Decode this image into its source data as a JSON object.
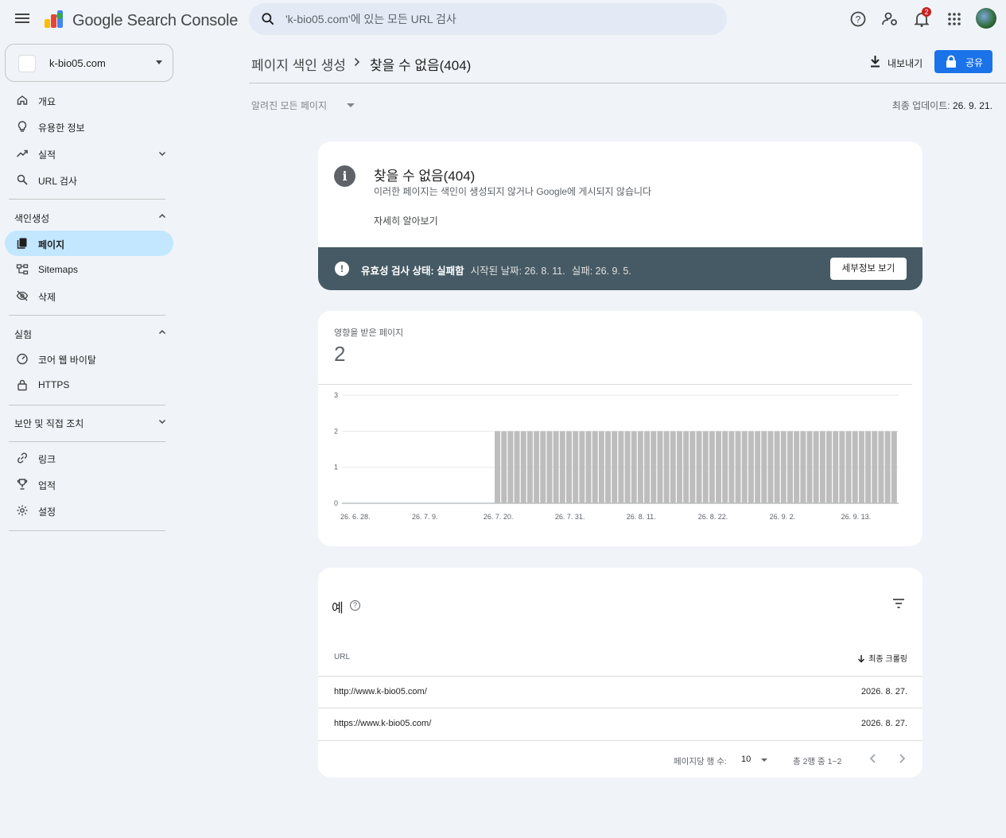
{
  "app": {
    "brand": "Google Search Console"
  },
  "search": {
    "placeholder": "'k-bio05.com'에 있는 모든 URL 검사"
  },
  "notifications": {
    "count": "2"
  },
  "property": {
    "name": "k-bio05.com"
  },
  "sidebar": {
    "top_items": [
      {
        "label": "개요",
        "icon": "home-icon"
      },
      {
        "label": "유용한 정보",
        "icon": "lightbulb-icon"
      },
      {
        "label": "실적",
        "icon": "trending-up-icon"
      },
      {
        "label": "URL 검사",
        "icon": "search-icon"
      }
    ],
    "indexing": {
      "label": "색인생성",
      "items": [
        {
          "label": "페이지",
          "icon": "pages-icon"
        },
        {
          "label": "Sitemaps",
          "icon": "sitemap-icon"
        },
        {
          "label": "삭제",
          "icon": "eye-off-icon"
        }
      ]
    },
    "experience": {
      "label": "실험",
      "items": [
        {
          "label": "코어 웹 바이탈",
          "icon": "gauge-icon"
        },
        {
          "label": "HTTPS",
          "icon": "lock-icon"
        }
      ]
    },
    "security": {
      "label": "보안 및 직접 조치"
    },
    "bottom_items": [
      {
        "label": "링크",
        "icon": "link-icon"
      },
      {
        "label": "업적",
        "icon": "trophy-icon"
      },
      {
        "label": "설정",
        "icon": "gear-icon"
      }
    ]
  },
  "header": {
    "breadcrumb_parent": "페이지 색인 생성",
    "breadcrumb_current": "찾을 수 없음(404)",
    "export_label": "내보내기",
    "share_label": "공유",
    "filter_label": "알려진 모든 페이지",
    "updated_prefix": "최종 업데이트:",
    "updated_value": "26. 9. 21."
  },
  "info_card": {
    "title": "찾을 수 없음(404)",
    "description": "이러한 페이지는 색인이 생성되지 않거나 Google에 게시되지 않습니다",
    "learn_more": "자세히 알아보기",
    "status_label": "유효성 검사 상태: 실패함",
    "started": "시작된 날짜: 26. 8. 11.",
    "failed": "실패: 26. 9. 5.",
    "details_button": "세부정보 보기"
  },
  "affected": {
    "label": "영향을 받은 페이지",
    "value": "2"
  },
  "chart_data": {
    "type": "bar",
    "y_ticks": [
      "0",
      "1",
      "2",
      "3"
    ],
    "ylim": [
      0,
      3
    ],
    "x_tick_labels": [
      "26. 6. 28.",
      "26. 7. 9.",
      "26. 7. 20.",
      "26. 7. 31.",
      "26. 8. 11.",
      "26. 8. 22.",
      "26. 9. 2.",
      "26. 9. 13."
    ],
    "x_start": "26. 6. 28.",
    "x_end": "26. 9. 20.",
    "series": [
      {
        "bars_zero_until": "26. 7. 20.",
        "value_after": 2,
        "bars_from": "26. 7. 21.",
        "bars_to": "26. 9. 20.",
        "color": "#bdbdbd"
      }
    ]
  },
  "table": {
    "title": "예",
    "col_url": "URL",
    "col_date": "최종 크롤링",
    "rows": [
      {
        "url": "http://www.k-bio05.com/",
        "date": "2026. 8. 27."
      },
      {
        "url": "https://www.k-bio05.com/",
        "date": "2026. 8. 27."
      }
    ],
    "rows_per_page_label": "페이지당 행 수:",
    "rows_per_page_value": "10",
    "range": "총 2행 중 1~2"
  },
  "colors": {
    "accent": "#1a73e8",
    "active_nav": "#c2e7ff",
    "status_bar": "#455a64",
    "bars": "#bdbdbd"
  }
}
